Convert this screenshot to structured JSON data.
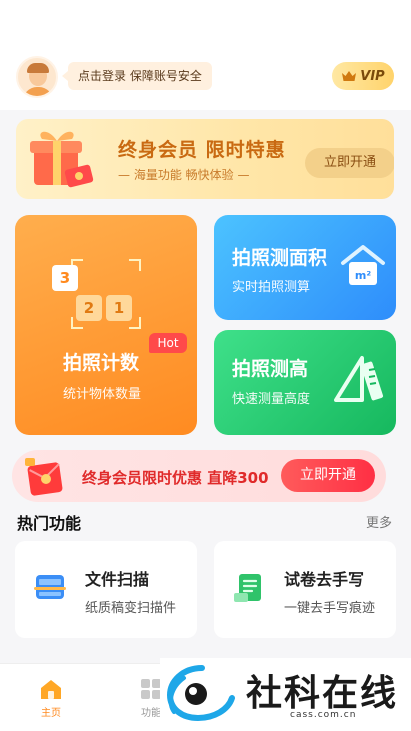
{
  "header": {
    "login_tip": "点击登录 保障账号安全",
    "vip_label": "VIP"
  },
  "promo": {
    "title": "终身会员 限时特惠",
    "subtitle": "— 海量功能 畅快体验 —",
    "button": "立即开通"
  },
  "cards": {
    "count": {
      "title": "拍照计数",
      "desc": "统计物体数量",
      "hot": "Hot",
      "digits": [
        "3",
        "2",
        "1"
      ]
    },
    "area": {
      "title": "拍照测面积",
      "desc": "实时拍照测算",
      "unit": "m²"
    },
    "height": {
      "title": "拍照测高",
      "desc": "快速测量高度"
    }
  },
  "strip": {
    "text": "终身会员限时优惠 直降300",
    "button": "立即开通"
  },
  "hot_section": {
    "title": "热门功能",
    "more": "更多"
  },
  "features": [
    {
      "title": "文件扫描",
      "desc": "纸质稿变扫描件"
    },
    {
      "title": "试卷去手写",
      "desc": "一键去手写痕迹"
    }
  ],
  "tabbar": {
    "home": "主页",
    "func": "功能"
  },
  "watermark": {
    "name": "社科在线",
    "domain": "cass.com.cn"
  },
  "colors": {
    "accent_orange": "#ff8b21",
    "accent_blue": "#2e8dfb",
    "accent_green": "#16b85e",
    "accent_red": "#ff2f44"
  }
}
